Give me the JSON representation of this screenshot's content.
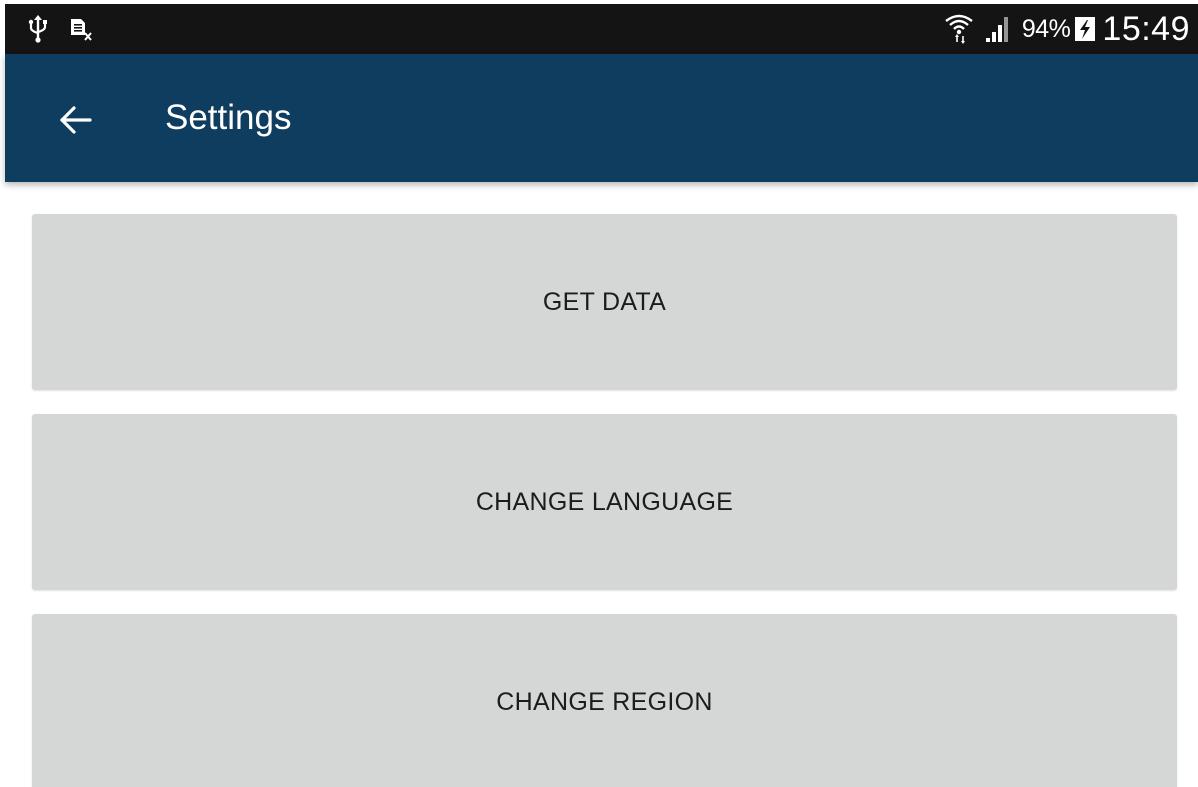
{
  "status_bar": {
    "left_icons": [
      "usb-icon",
      "sim-card-missing-icon"
    ],
    "right_icons": [
      "wifi-icon",
      "signal-icon",
      "battery-charging-icon"
    ],
    "battery_percent": "94%",
    "time": "15:49"
  },
  "app_bar": {
    "back_icon": "arrow-back-icon",
    "title": "Settings",
    "color": "#0e3d5f"
  },
  "buttons": [
    {
      "label": "GET DATA"
    },
    {
      "label": "CHANGE LANGUAGE"
    },
    {
      "label": "CHANGE REGION"
    }
  ],
  "colors": {
    "status_bar": "#141414",
    "button_background": "#d5d6d6",
    "button_text": "#1c1c1c"
  }
}
